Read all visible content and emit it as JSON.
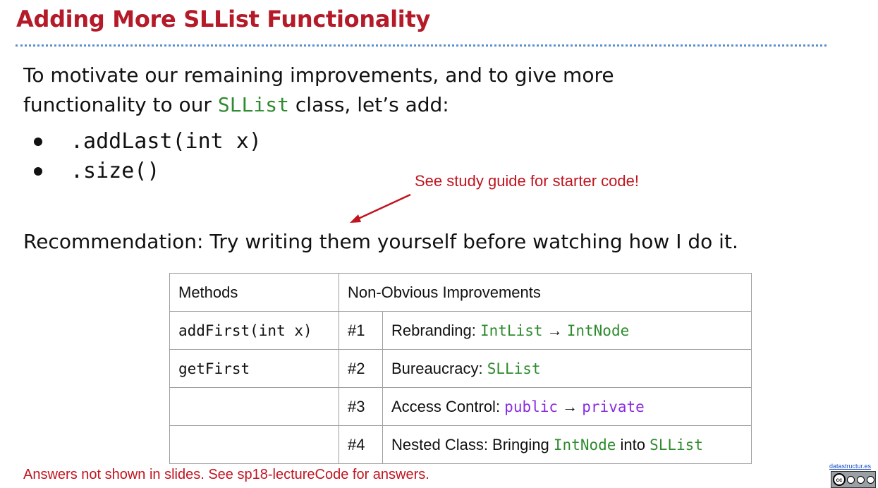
{
  "slide": {
    "title": "Adding More SLList Functionality",
    "intro_line1": "To motivate our remaining improvements, and to give more",
    "intro_line2_pre": "functionality to our ",
    "intro_line2_code": "SLList",
    "intro_line2_post": " class, let’s add:",
    "bullets": [
      ".addLast(int x)",
      ".size()"
    ],
    "callout": "See study guide for starter code!",
    "recommendation": "Recommendation: Try writing them yourself before watching how I do it.",
    "footer_note": "Answers not shown in slides. See sp18-lectureCode for answers.",
    "site_link": "datastructur.es",
    "license_badge_icon": "creative-commons-by-nc-sa-icon"
  },
  "table": {
    "header_methods": "Methods",
    "header_improvements": "Non-Obvious Improvements",
    "rows": [
      {
        "method": "addFirst(int x)",
        "num": "#1",
        "label": "Rebranding: ",
        "code1": "IntList",
        "sep": " → ",
        "code2": "IntNode",
        "mid": "",
        "code3": ""
      },
      {
        "method": "getFirst",
        "num": "#2",
        "label": "Bureaucracy: ",
        "code1": "SLList",
        "sep": "",
        "code2": "",
        "mid": "",
        "code3": ""
      },
      {
        "method": "",
        "num": "#3",
        "label": "Access Control: ",
        "code1": "public",
        "sep": " → ",
        "code2": "private",
        "mid": "",
        "code3": ""
      },
      {
        "method": "",
        "num": "#4",
        "label": "Nested Class: Bringing ",
        "code1": "IntNode",
        "sep": "",
        "code2": "",
        "mid": " into ",
        "code3": "SLList"
      }
    ]
  },
  "colors": {
    "title": "#b41a28",
    "callout": "#c0141f",
    "code_green": "#2e8b2e",
    "code_purple": "#8a2be2"
  }
}
